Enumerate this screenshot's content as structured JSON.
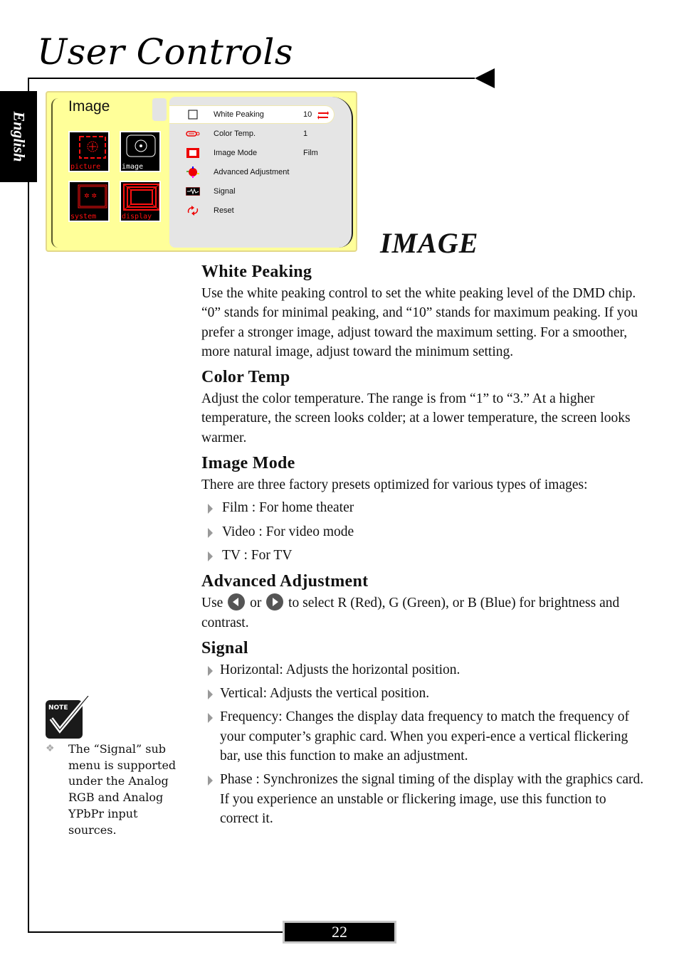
{
  "header": {
    "title": "User Controls",
    "language_tab": "English"
  },
  "osd": {
    "category_title": "Image",
    "tiles": [
      {
        "label": "picture",
        "icon": "picture-icon",
        "active": false
      },
      {
        "label": "image",
        "icon": "image-icon",
        "active": true
      },
      {
        "label": "system",
        "icon": "system-icon",
        "active": false
      },
      {
        "label": "display",
        "icon": "display-icon",
        "active": false
      }
    ],
    "menu_items": [
      {
        "icon": "white-peaking-icon",
        "label": "White Peaking",
        "value": "10",
        "selected": true
      },
      {
        "icon": "color-temp-icon",
        "label": "Color Temp.",
        "value": "1",
        "selected": false
      },
      {
        "icon": "image-mode-icon",
        "label": "Image Mode",
        "value": "Film",
        "selected": false
      },
      {
        "icon": "advanced-adjustment-icon",
        "label": "Advanced Adjustment",
        "value": "",
        "selected": false
      },
      {
        "icon": "signal-icon",
        "label": "Signal",
        "value": "",
        "selected": false
      },
      {
        "icon": "reset-icon",
        "label": "Reset",
        "value": "",
        "selected": false
      }
    ],
    "colors": {
      "background": "#ffff99",
      "panel": "#e5e5e5",
      "accent": "#ff0000"
    }
  },
  "section_title": "IMAGE",
  "sections": {
    "white_peaking": {
      "heading": "White Peaking",
      "body": "Use the white peaking control to set the white peaking level of the DMD chip.  “0” stands for minimal peaking, and “10” stands for maximum peaking.  If you prefer a stronger image, adjust toward the maximum setting.  For a smoother, more natural image, adjust toward the minimum setting."
    },
    "color_temp": {
      "heading": "Color Temp",
      "body": "Adjust the color temperature.  The range is from “1” to “3.”  At a higher temperature, the screen looks colder; at a lower temperature, the screen looks warmer."
    },
    "image_mode": {
      "heading": "Image Mode",
      "body": "There are three factory presets optimized for various types of images:",
      "items": [
        "Film : For home theater",
        "Video : For video mode",
        "TV : For TV"
      ]
    },
    "advanced_adjustment": {
      "heading": "Advanced Adjustment",
      "body_prefix": "Use",
      "body_middle": "or",
      "body_suffix": "to select R (Red), G (Green), or B (Blue) for brightness and contrast."
    },
    "signal": {
      "heading": "Signal",
      "items": [
        "Horizontal: Adjusts the horizontal position.",
        "Vertical: Adjusts the vertical position.",
        "Frequency: Changes the display data frequency to match the frequency of your computer’s graphic card. When you experi-ence a vertical flickering bar, use this function to make an adjustment.",
        "Phase : Synchronizes the signal timing of the display with the graphics card. If you experience an unstable or flickering image, use this function to correct it."
      ]
    }
  },
  "note": {
    "badge": "NOTE",
    "text": "The “Signal” sub menu is supported under the Analog RGB and Analog YPbPr input sources."
  },
  "footer": {
    "page_number": "22"
  }
}
